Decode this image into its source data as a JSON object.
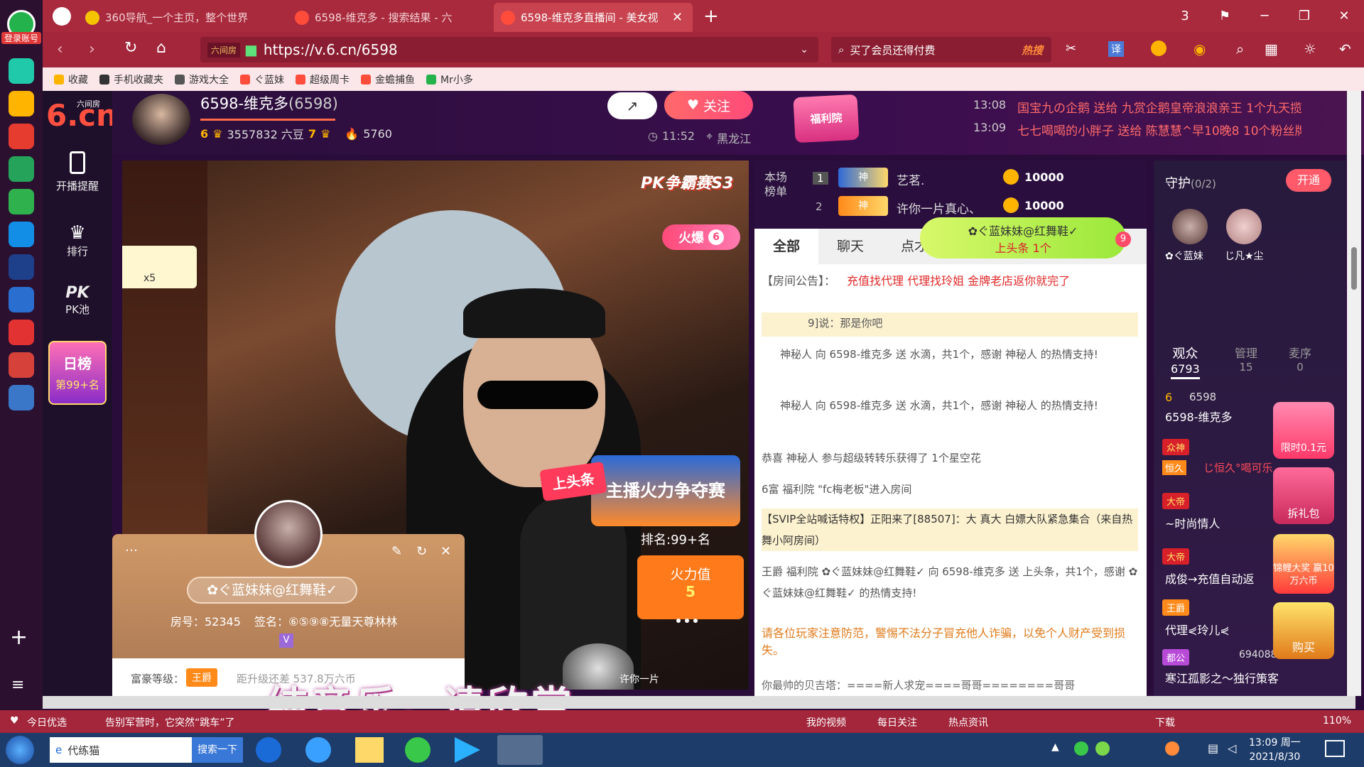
{
  "browser": {
    "tabs": [
      {
        "label": "360导航_一个主页，整个世界",
        "color": "#f5c400"
      },
      {
        "label": "6598-维克多 - 搜索结果 - 六",
        "color": "#ff4c3b"
      },
      {
        "label": "6598-维克多直播间 - 美女视",
        "color": "#ff4c3b"
      }
    ],
    "tab_count": "3",
    "url_badge": "六间房",
    "url": "https://v.6.cn/6598",
    "search_text": "买了会员还得付费",
    "hot_label": "热搜",
    "translate_label": "译",
    "bookmarks": [
      "收藏",
      "手机收藏夹",
      "游戏大全",
      "ぐ蓝妹",
      "超级周卡",
      "金蟾捕鱼",
      "Mr小多"
    ],
    "login_label": "登录账号"
  },
  "site": {
    "logo": "6.cn",
    "logo_sub": "六间房",
    "nav": [
      {
        "label": "开播提醒",
        "icon": "phone-icon"
      },
      {
        "label": "排行",
        "icon": "crown-icon"
      },
      {
        "label": "PK池",
        "icon": "pk-icon"
      }
    ],
    "daily_rank_title": "日榜",
    "daily_rank_value": "第99+名"
  },
  "host": {
    "name": "6598-维克多",
    "room_id": "(6598)",
    "level": "6",
    "beans": "3557832 六豆",
    "rich_level": "7",
    "fire": "5760",
    "time": "11:52",
    "location": "黑龙江",
    "follow": "关注"
  },
  "gift_ticker": {
    "badge": "福利院",
    "items": [
      {
        "time": "13:08",
        "text": "国宝九の企鹅 送给 九赏企鹅皇帝浪浪亲王 1个九天揽月"
      },
      {
        "time": "13:09",
        "text": "七七喝喝的小胖子 送给 陈慧慧^早10晚8 10个粉丝牌"
      }
    ]
  },
  "video": {
    "pk_title": "PK争霸赛S3",
    "hot_label": "火爆",
    "hot_level": "6",
    "fan_count": "x5",
    "headline_tag": "上头条",
    "campaign_title": "主播火力争夺赛",
    "campaign_rank": "排名:99+名",
    "fire_label": "火力值",
    "fire_value": "5",
    "subtitle": "纯音乐，请欣赏",
    "bottom_name": "许你一片"
  },
  "profile_card": {
    "name": "✿ぐ蓝妹妹@红舞鞋✓",
    "room": "房号：52345",
    "sign": "签名：⑥⑤⑨⑧无量天尊林林",
    "rich_label": "富豪等级：",
    "rich_badge": "王爵",
    "upgrade": "距升级还差 537.8万六币"
  },
  "rank_board": {
    "title": "本场榜单",
    "rows": [
      {
        "rank": "1",
        "name": "艺茗.",
        "badge": "神",
        "score": "10000"
      },
      {
        "rank": "2",
        "name": "许你一片真心、",
        "badge": "神",
        "score": "10000"
      }
    ]
  },
  "headline_bubble": {
    "name": "✿ぐ蓝妹妹@红舞鞋✓",
    "text": "上头条 1个",
    "count": "9"
  },
  "chat": {
    "tabs": [
      "全部",
      "聊天",
      "点才"
    ],
    "notice_label": "【房间公告】：",
    "notice": "充值找代理 代理找玲姐 金牌老店返你就完了",
    "messages": [
      {
        "text": "9]说：那是你吧"
      },
      {
        "text": "神秘人 向 6598-维克多 送 水滴，共1个，感谢 神秘人 的热情支持!"
      },
      {
        "text": "神秘人 向 6598-维克多 送 水滴，共1个，感谢 神秘人 的热情支持!"
      },
      {
        "text": "恭喜 神秘人 参与超级转转乐获得了 1个星空花"
      },
      {
        "text": "6富 福利院 \"fc梅老板\"进入房间"
      },
      {
        "text": "【SVIP全站喊话特权】正阳来了[88507]：大 真大 白嫖大队紧急集合（来自热舞小阿房间）"
      },
      {
        "text": "王爵 福利院 ✿ぐ蓝妹妹@红舞鞋✓ 向 6598-维克多 送 上头条，共1个，感谢 ✿ぐ蓝妹妹@红舞鞋✓ 的热情支持!"
      }
    ],
    "warning": "请各位玩家注意防范，警惕不法分子冒充他人诈骗，以免个人财产受到损失。",
    "input_hint": "你最帅的贝吉塔：====新人求宠====哥哥========哥哥"
  },
  "audience": {
    "guard_label": "守护",
    "guard_count": "(0/2)",
    "open_label": "开通",
    "guards": [
      "✿ぐ蓝妹",
      "じ凡★尘"
    ],
    "tabs": [
      {
        "label": "观众",
        "count": "6793"
      },
      {
        "label": "管理",
        "count": "15"
      },
      {
        "label": "麦序",
        "count": "0"
      }
    ],
    "users": [
      {
        "badge": "6",
        "name": "6598-维克多",
        "sub": "6598"
      },
      {
        "badge": "众神",
        "name": "じ恒久°喝可乐",
        "sub": "恒久"
      },
      {
        "badge": "大帝",
        "name": "~时尚情人",
        "sub": ""
      },
      {
        "badge": "大帝",
        "name": "成俊→充值自动返",
        "sub": ""
      },
      {
        "badge": "王爵",
        "name": "代理⋞玲儿⋞",
        "sub": ""
      },
      {
        "badge": "都公",
        "name": "寒江孤影之～独行策客",
        "sub": "694088"
      }
    ],
    "promos": [
      "限时0.1元",
      "拆礼包",
      "锦鲤大奖 赢10万六币",
      "购买"
    ]
  },
  "statusbar": {
    "left": [
      "今日优选",
      "告别军营时，它突然“跳车”了"
    ],
    "right": [
      "我的视频",
      "每日关注",
      "热点资讯",
      "下载"
    ],
    "zoom": "110%"
  },
  "taskbar": {
    "search_label": "代练猫",
    "search_button": "搜索一下",
    "time": "13:09 周一",
    "date": "2021/8/30"
  }
}
